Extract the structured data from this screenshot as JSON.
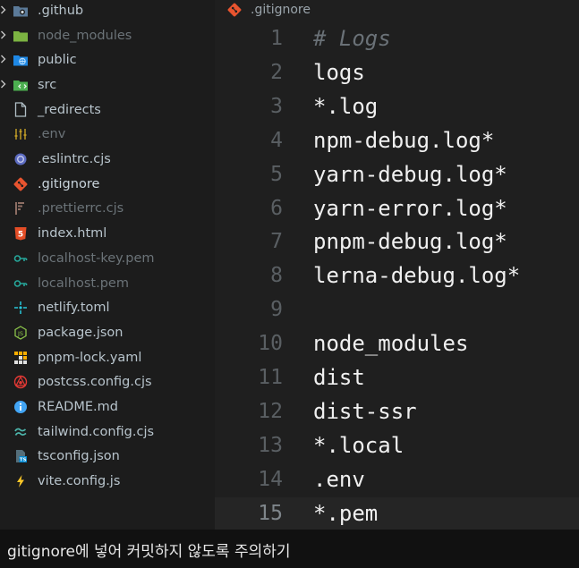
{
  "explorer": {
    "items": [
      {
        "label": ".github",
        "icon": "folder-github-icon",
        "folder": true,
        "dim": false
      },
      {
        "label": "node_modules",
        "icon": "folder-node-icon",
        "folder": true,
        "dim": true
      },
      {
        "label": "public",
        "icon": "folder-public-icon",
        "folder": true,
        "dim": false
      },
      {
        "label": "src",
        "icon": "folder-src-icon",
        "folder": true,
        "dim": false
      },
      {
        "label": "_redirects",
        "icon": "file-icon",
        "folder": false,
        "dim": false
      },
      {
        "label": ".env",
        "icon": "env-icon",
        "folder": false,
        "dim": true
      },
      {
        "label": ".eslintrc.cjs",
        "icon": "eslint-icon",
        "folder": false,
        "dim": false
      },
      {
        "label": ".gitignore",
        "icon": "git-icon",
        "folder": false,
        "dim": false,
        "active": true
      },
      {
        "label": ".prettierrc.cjs",
        "icon": "prettier-icon",
        "folder": false,
        "dim": true
      },
      {
        "label": "index.html",
        "icon": "html-icon",
        "folder": false,
        "dim": false
      },
      {
        "label": "localhost-key.pem",
        "icon": "key-icon",
        "folder": false,
        "dim": true
      },
      {
        "label": "localhost.pem",
        "icon": "key-icon",
        "folder": false,
        "dim": true
      },
      {
        "label": "netlify.toml",
        "icon": "netlify-icon",
        "folder": false,
        "dim": false
      },
      {
        "label": "package.json",
        "icon": "nodejs-icon",
        "folder": false,
        "dim": false
      },
      {
        "label": "pnpm-lock.yaml",
        "icon": "pnpm-icon",
        "folder": false,
        "dim": false
      },
      {
        "label": "postcss.config.cjs",
        "icon": "postcss-icon",
        "folder": false,
        "dim": false
      },
      {
        "label": "README.md",
        "icon": "info-icon",
        "folder": false,
        "dim": false
      },
      {
        "label": "tailwind.config.cjs",
        "icon": "tailwind-icon",
        "folder": false,
        "dim": false
      },
      {
        "label": "tsconfig.json",
        "icon": "typescript-icon",
        "folder": false,
        "dim": false
      },
      {
        "label": "vite.config.js",
        "icon": "vite-icon",
        "folder": false,
        "dim": false
      }
    ]
  },
  "tab": {
    "label": ".gitignore",
    "icon": "git-icon"
  },
  "editor": {
    "current_line": 15,
    "lines": [
      {
        "num": "1",
        "text": "# Logs",
        "comment": true
      },
      {
        "num": "2",
        "text": "logs"
      },
      {
        "num": "3",
        "text": "*.log"
      },
      {
        "num": "4",
        "text": "npm-debug.log*"
      },
      {
        "num": "5",
        "text": "yarn-debug.log*"
      },
      {
        "num": "6",
        "text": "yarn-error.log*"
      },
      {
        "num": "7",
        "text": "pnpm-debug.log*"
      },
      {
        "num": "8",
        "text": "lerna-debug.log*"
      },
      {
        "num": "9",
        "text": ""
      },
      {
        "num": "10",
        "text": "node_modules"
      },
      {
        "num": "11",
        "text": "dist"
      },
      {
        "num": "12",
        "text": "dist-ssr"
      },
      {
        "num": "13",
        "text": "*.local"
      },
      {
        "num": "14",
        "text": ".env"
      },
      {
        "num": "15",
        "text": "*.pem"
      }
    ]
  },
  "caption": {
    "text": "gitignore에 넣어 커밋하지 않도록 주의하기"
  },
  "colors": {
    "background": "#1f1f1f",
    "sidebar": "#1c1c1c",
    "text": "#f0f0f0",
    "comment": "#6a7177",
    "line_number": "#5a5f63",
    "git": "#e8542f"
  }
}
